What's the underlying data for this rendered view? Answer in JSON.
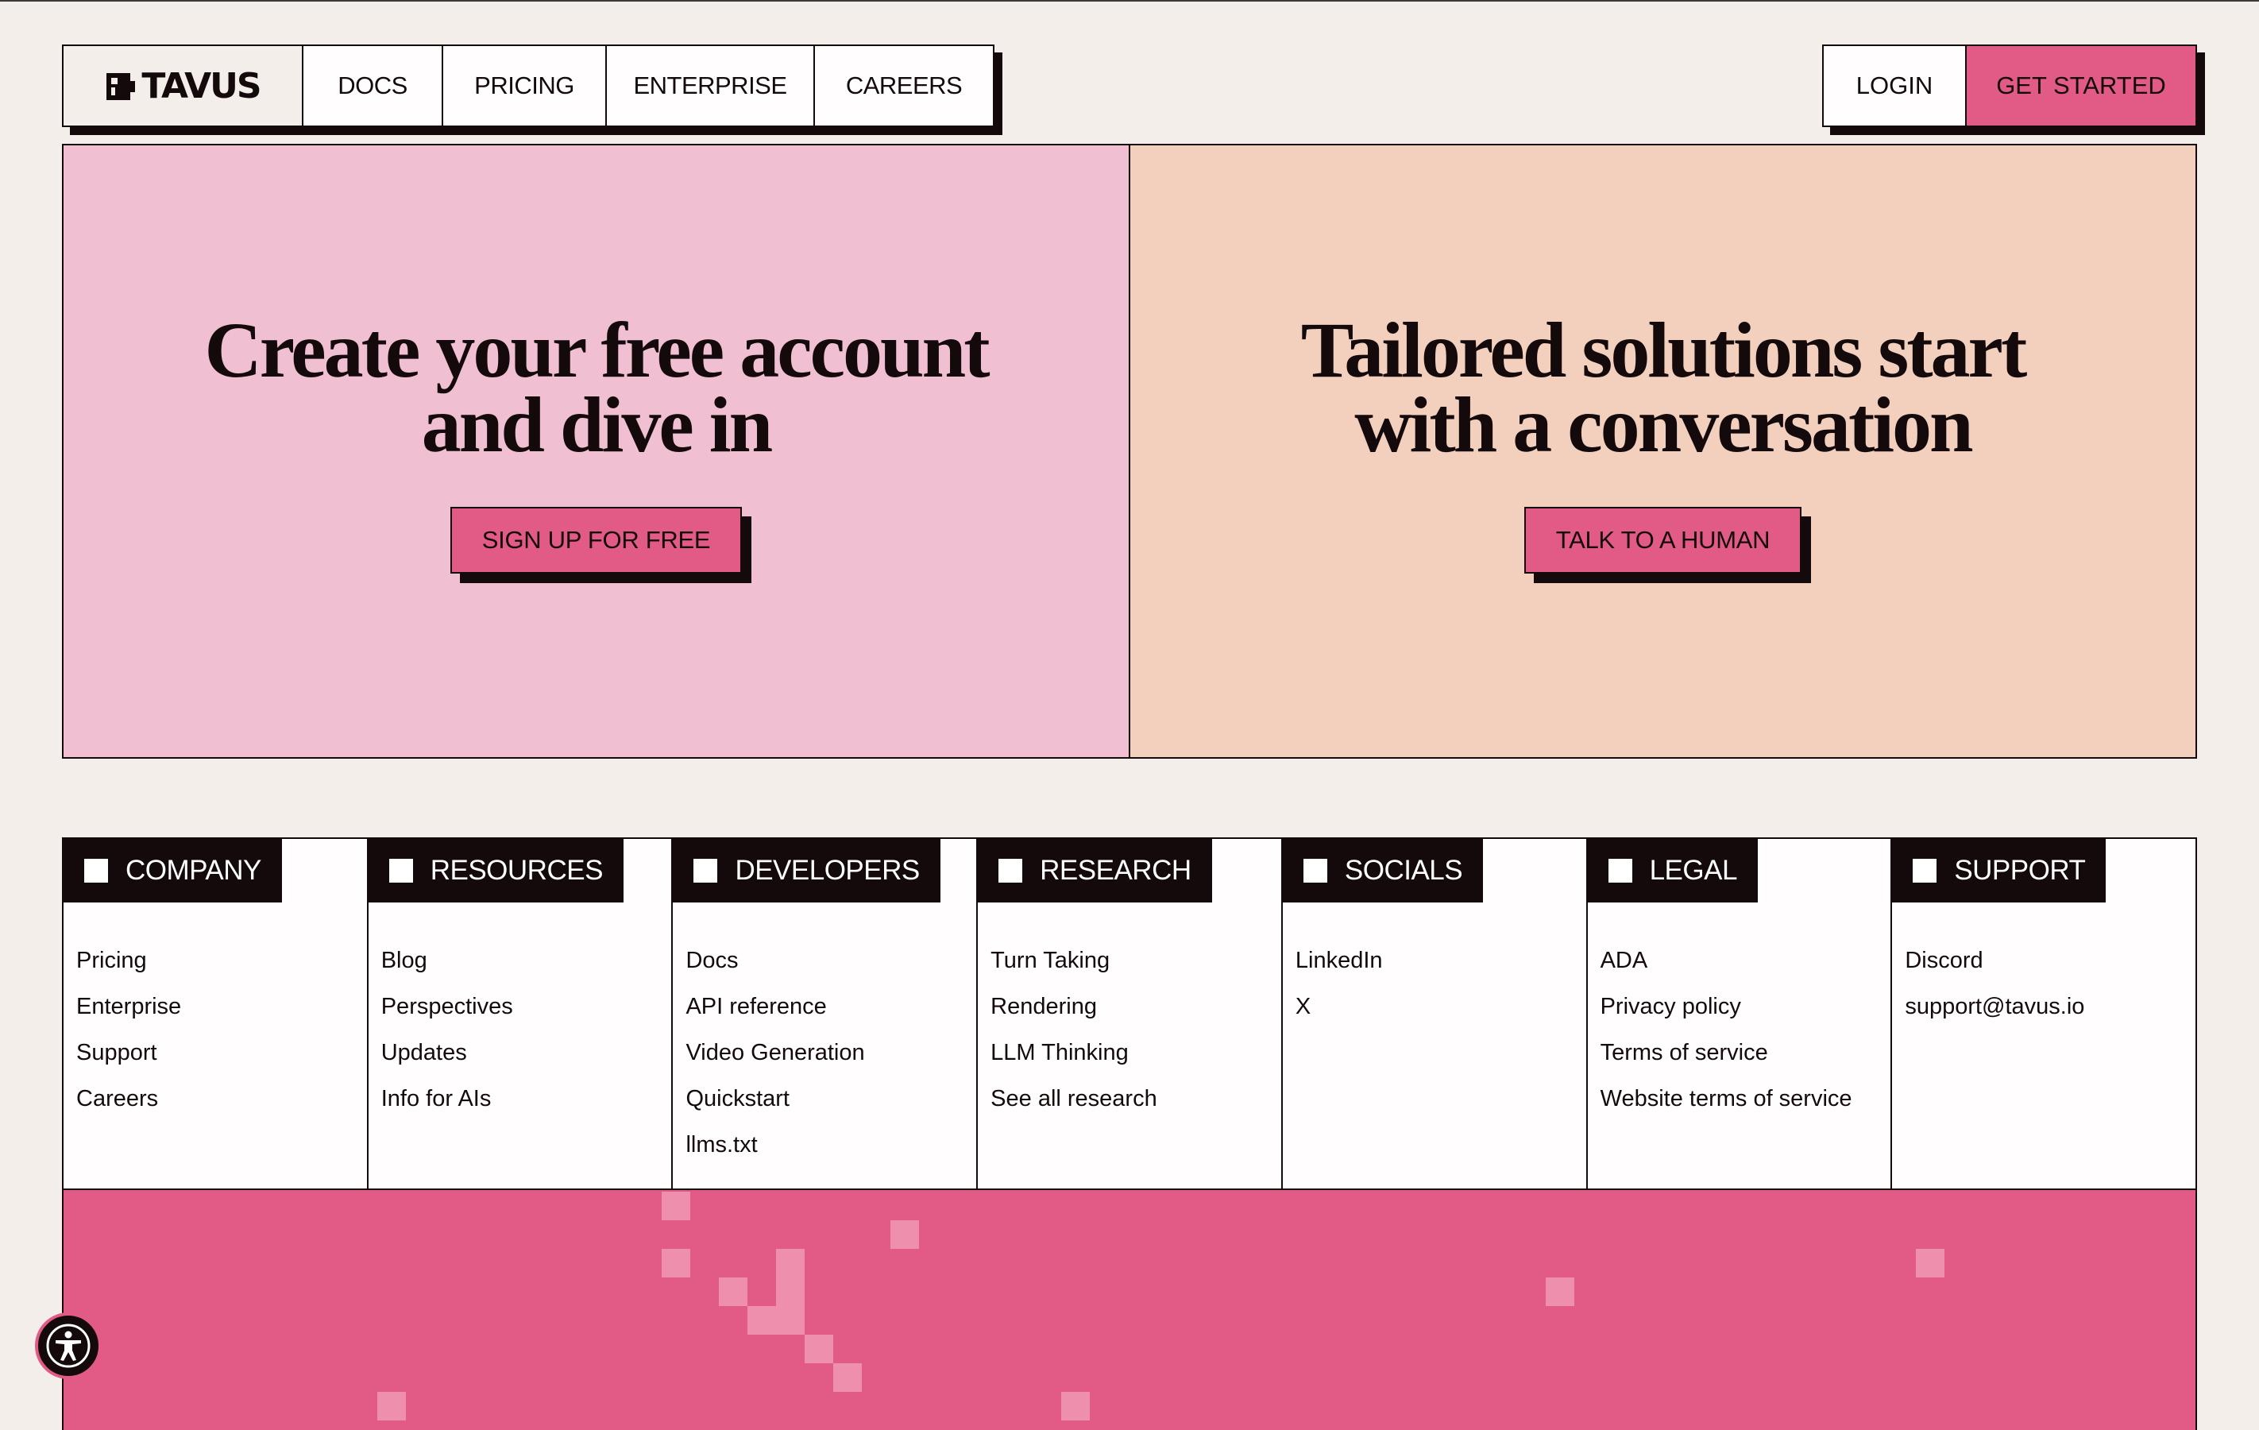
{
  "nav": {
    "logo_text": "TAVUS",
    "links": [
      {
        "label": "DOCS"
      },
      {
        "label": "PRICING"
      },
      {
        "label": "ENTERPRISE"
      },
      {
        "label": "CAREERS"
      }
    ],
    "login_label": "LOGIN",
    "get_started_label": "GET STARTED"
  },
  "hero": {
    "left": {
      "title": "Create your free account and dive in",
      "cta": "SIGN UP FOR FREE"
    },
    "right": {
      "title": "Tailored solutions start with a conversation",
      "cta": "TALK TO A HUMAN"
    }
  },
  "footer": {
    "columns": [
      {
        "heading": "COMPANY",
        "links": [
          "Pricing",
          "Enterprise",
          "Support",
          "Careers"
        ]
      },
      {
        "heading": "RESOURCES",
        "links": [
          "Blog",
          "Perspectives",
          "Updates",
          "Info for AIs"
        ]
      },
      {
        "heading": "DEVELOPERS",
        "links": [
          "Docs",
          "API reference",
          "Video Generation",
          "Quickstart",
          "llms.txt"
        ]
      },
      {
        "heading": "RESEARCH",
        "links": [
          "Turn Taking",
          "Rendering",
          "LLM Thinking",
          "See all research"
        ]
      },
      {
        "heading": "SOCIALS",
        "links": [
          "LinkedIn",
          "X"
        ]
      },
      {
        "heading": "LEGAL",
        "links": [
          "ADA",
          "Privacy policy",
          "Terms of service",
          "Website terms of service"
        ]
      },
      {
        "heading": "SUPPORT",
        "links": [
          "Discord",
          "support@tavus.io"
        ]
      }
    ]
  },
  "colors": {
    "background": "#f3eeea",
    "accent_pink": "#e25a86",
    "panel_pink": "#f1bfd2",
    "panel_peach": "#f3d0be",
    "ink": "#140a0c"
  },
  "icons": {
    "logo": "tavus-logo-icon",
    "accessibility": "accessibility-icon",
    "heading_marker": "square-icon"
  }
}
